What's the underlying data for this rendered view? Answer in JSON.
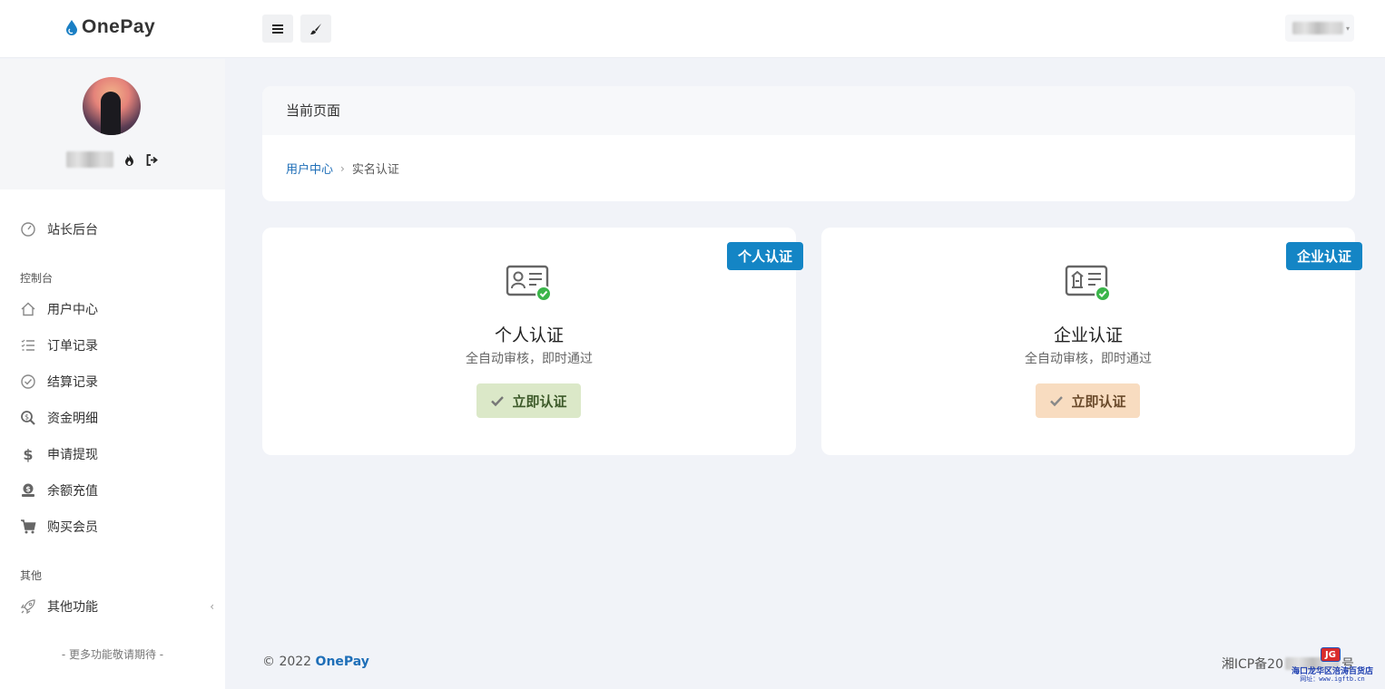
{
  "header": {
    "brand": "OnePay",
    "menu_icon": "hamburger-icon",
    "theme_icon": "brush-icon"
  },
  "sidebar": {
    "profile": {
      "fire_icon": "fire-icon",
      "logout_icon": "logout-icon"
    },
    "top_item": {
      "label": "站长后台",
      "icon": "gauge-icon"
    },
    "section_console": "控制台",
    "items": [
      {
        "label": "用户中心",
        "icon": "home-icon"
      },
      {
        "label": "订单记录",
        "icon": "list-icon"
      },
      {
        "label": "结算记录",
        "icon": "check-circle-icon"
      },
      {
        "label": "资金明细",
        "icon": "search-dollar-icon"
      },
      {
        "label": "申请提现",
        "icon": "dollar-icon"
      },
      {
        "label": "余额充值",
        "icon": "coins-icon"
      },
      {
        "label": "购买会员",
        "icon": "cart-icon"
      }
    ],
    "section_other": "其他",
    "other_item": {
      "label": "其他功能",
      "icon": "rocket-icon",
      "arrow": "‹"
    },
    "more_text": "- 更多功能敬请期待 -"
  },
  "breadcrumb_card": {
    "title": "当前页面",
    "crumbs": {
      "parent": "用户中心",
      "separator": "›",
      "current": "实名认证"
    }
  },
  "cards": [
    {
      "ribbon": "个人认证",
      "icon": "id-card-check-icon",
      "title": "个人认证",
      "desc": "全自动审核，即时通过",
      "button": "立即认证",
      "button_color": "#dbe8c8"
    },
    {
      "ribbon": "企业认证",
      "icon": "business-card-check-icon",
      "title": "企业认证",
      "desc": "全自动审核，即时通过",
      "button": "立即认证",
      "button_color": "#f8dcc0"
    }
  ],
  "footer": {
    "copyright": "© 2022",
    "brand": "OnePay",
    "icp_prefix": "湘ICP备20",
    "icp_suffix": "号"
  },
  "watermark": {
    "logo": "JG",
    "line1": "海口龙华区涪涛百货店",
    "line2": "网址：www.igftb.cn"
  },
  "colors": {
    "accent": "#1485c5",
    "link": "#1f6fb8",
    "check": "#4caf50"
  }
}
